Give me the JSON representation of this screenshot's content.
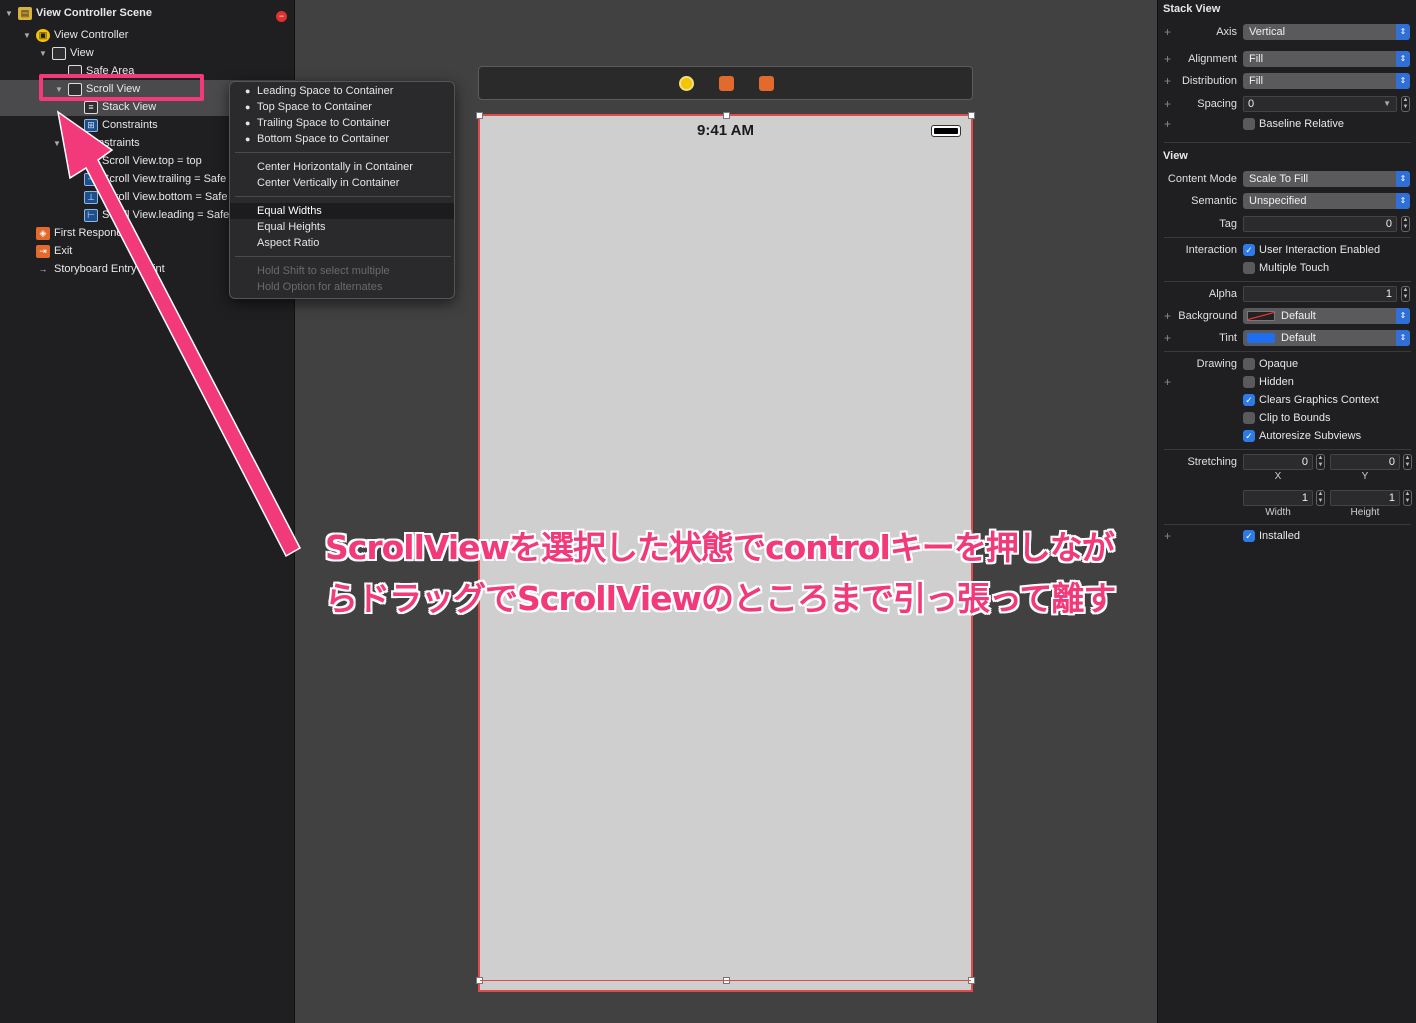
{
  "outline": {
    "scene": "View Controller Scene",
    "view_controller": "View Controller",
    "view": "View",
    "safe_area": "Safe Area",
    "scroll_view": "Scroll View",
    "stack_view": "Stack View",
    "constraints": "Constraints",
    "constraints_group": "Constraints",
    "constraint_items": [
      "Scroll View.top = top",
      "Scroll View.trailing = Safe",
      "Scroll View.bottom = Safe",
      "Scroll View.leading = Safe"
    ],
    "first_responder": "First Responder",
    "exit": "Exit",
    "storyboard_entry": "Storyboard Entry Point"
  },
  "menu": {
    "items": [
      {
        "label": "Leading Space to Container",
        "bullet": true
      },
      {
        "label": "Top Space to Container",
        "bullet": true
      },
      {
        "label": "Trailing Space to Container",
        "bullet": true
      },
      {
        "label": "Bottom Space to Container",
        "bullet": true
      },
      {
        "label": "Center Horizontally in Container",
        "bullet": false
      },
      {
        "label": "Center Vertically in Container",
        "bullet": false
      },
      {
        "label": "Equal Widths",
        "bullet": false,
        "highlighted": true
      },
      {
        "label": "Equal Heights",
        "bullet": false
      },
      {
        "label": "Aspect Ratio",
        "bullet": false
      },
      {
        "label": "Hold Shift to select multiple",
        "disabled": true
      },
      {
        "label": "Hold Option for alternates",
        "disabled": true
      }
    ]
  },
  "canvas": {
    "status_time": "9:41 AM",
    "accent_color": "#e04a4a"
  },
  "inspector": {
    "stack_view_header": "Stack View",
    "axis_label": "Axis",
    "axis_value": "Vertical",
    "alignment_label": "Alignment",
    "alignment_value": "Fill",
    "distribution_label": "Distribution",
    "distribution_value": "Fill",
    "spacing_label": "Spacing",
    "spacing_value": "0",
    "baseline_relative": "Baseline Relative",
    "view_header": "View",
    "content_mode_label": "Content Mode",
    "content_mode_value": "Scale To Fill",
    "semantic_label": "Semantic",
    "semantic_value": "Unspecified",
    "tag_label": "Tag",
    "tag_value": "0",
    "interaction_label": "Interaction",
    "user_interaction": "User Interaction Enabled",
    "multiple_touch": "Multiple Touch",
    "alpha_label": "Alpha",
    "alpha_value": "1",
    "background_label": "Background",
    "background_value": "Default",
    "tint_label": "Tint",
    "tint_value": "Default",
    "drawing_label": "Drawing",
    "opaque": "Opaque",
    "hidden": "Hidden",
    "clears_graphics": "Clears Graphics Context",
    "clip_to_bounds": "Clip to Bounds",
    "autoresize": "Autoresize Subviews",
    "stretching_label": "Stretching",
    "stretch_x": "0",
    "stretch_y": "0",
    "x_label": "X",
    "y_label": "Y",
    "stretch_w": "1",
    "stretch_h": "1",
    "width_label": "Width",
    "height_label": "Height",
    "installed": "Installed"
  },
  "annotation": {
    "text": "ScrollViewを選択した状態でcontrolキーを押しながらドラッグでScrollViewのところまで引っ張って離す",
    "color": "#f23a7a"
  }
}
